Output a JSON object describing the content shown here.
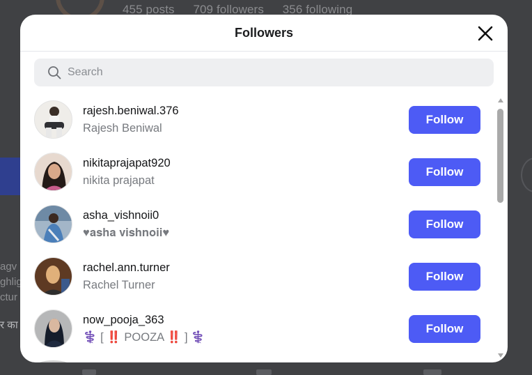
{
  "background": {
    "stats": {
      "posts": "455 posts",
      "followers": "709 followers",
      "following": "356 following"
    },
    "side_text": "agv ghlig ctur",
    "side_text2": "र का"
  },
  "modal": {
    "title": "Followers",
    "close_icon": "close-icon",
    "search": {
      "placeholder": "Search",
      "value": ""
    },
    "accent": "#4d5bf5",
    "followers": [
      {
        "username": "rajesh.beniwal.376",
        "fullname": "Rajesh Beniwal",
        "button": "Follow"
      },
      {
        "username": "nikitaprajapat920",
        "fullname": "nikita prajapat",
        "button": "Follow"
      },
      {
        "username": "asha_vishnoii0",
        "fullname": "♥𝐚𝐬𝐡𝐚 𝐯𝐢𝐬𝐡𝐧𝐨𝐢𝐢♥",
        "button": "Follow"
      },
      {
        "username": "rachel.ann.turner",
        "fullname": "Rachel Turner",
        "button": "Follow"
      },
      {
        "username": "now_pooja_363",
        "fullname": "⚕️ [ ‼️ POOZA ‼️ ] ⚕️",
        "button": "Follow"
      }
    ]
  }
}
